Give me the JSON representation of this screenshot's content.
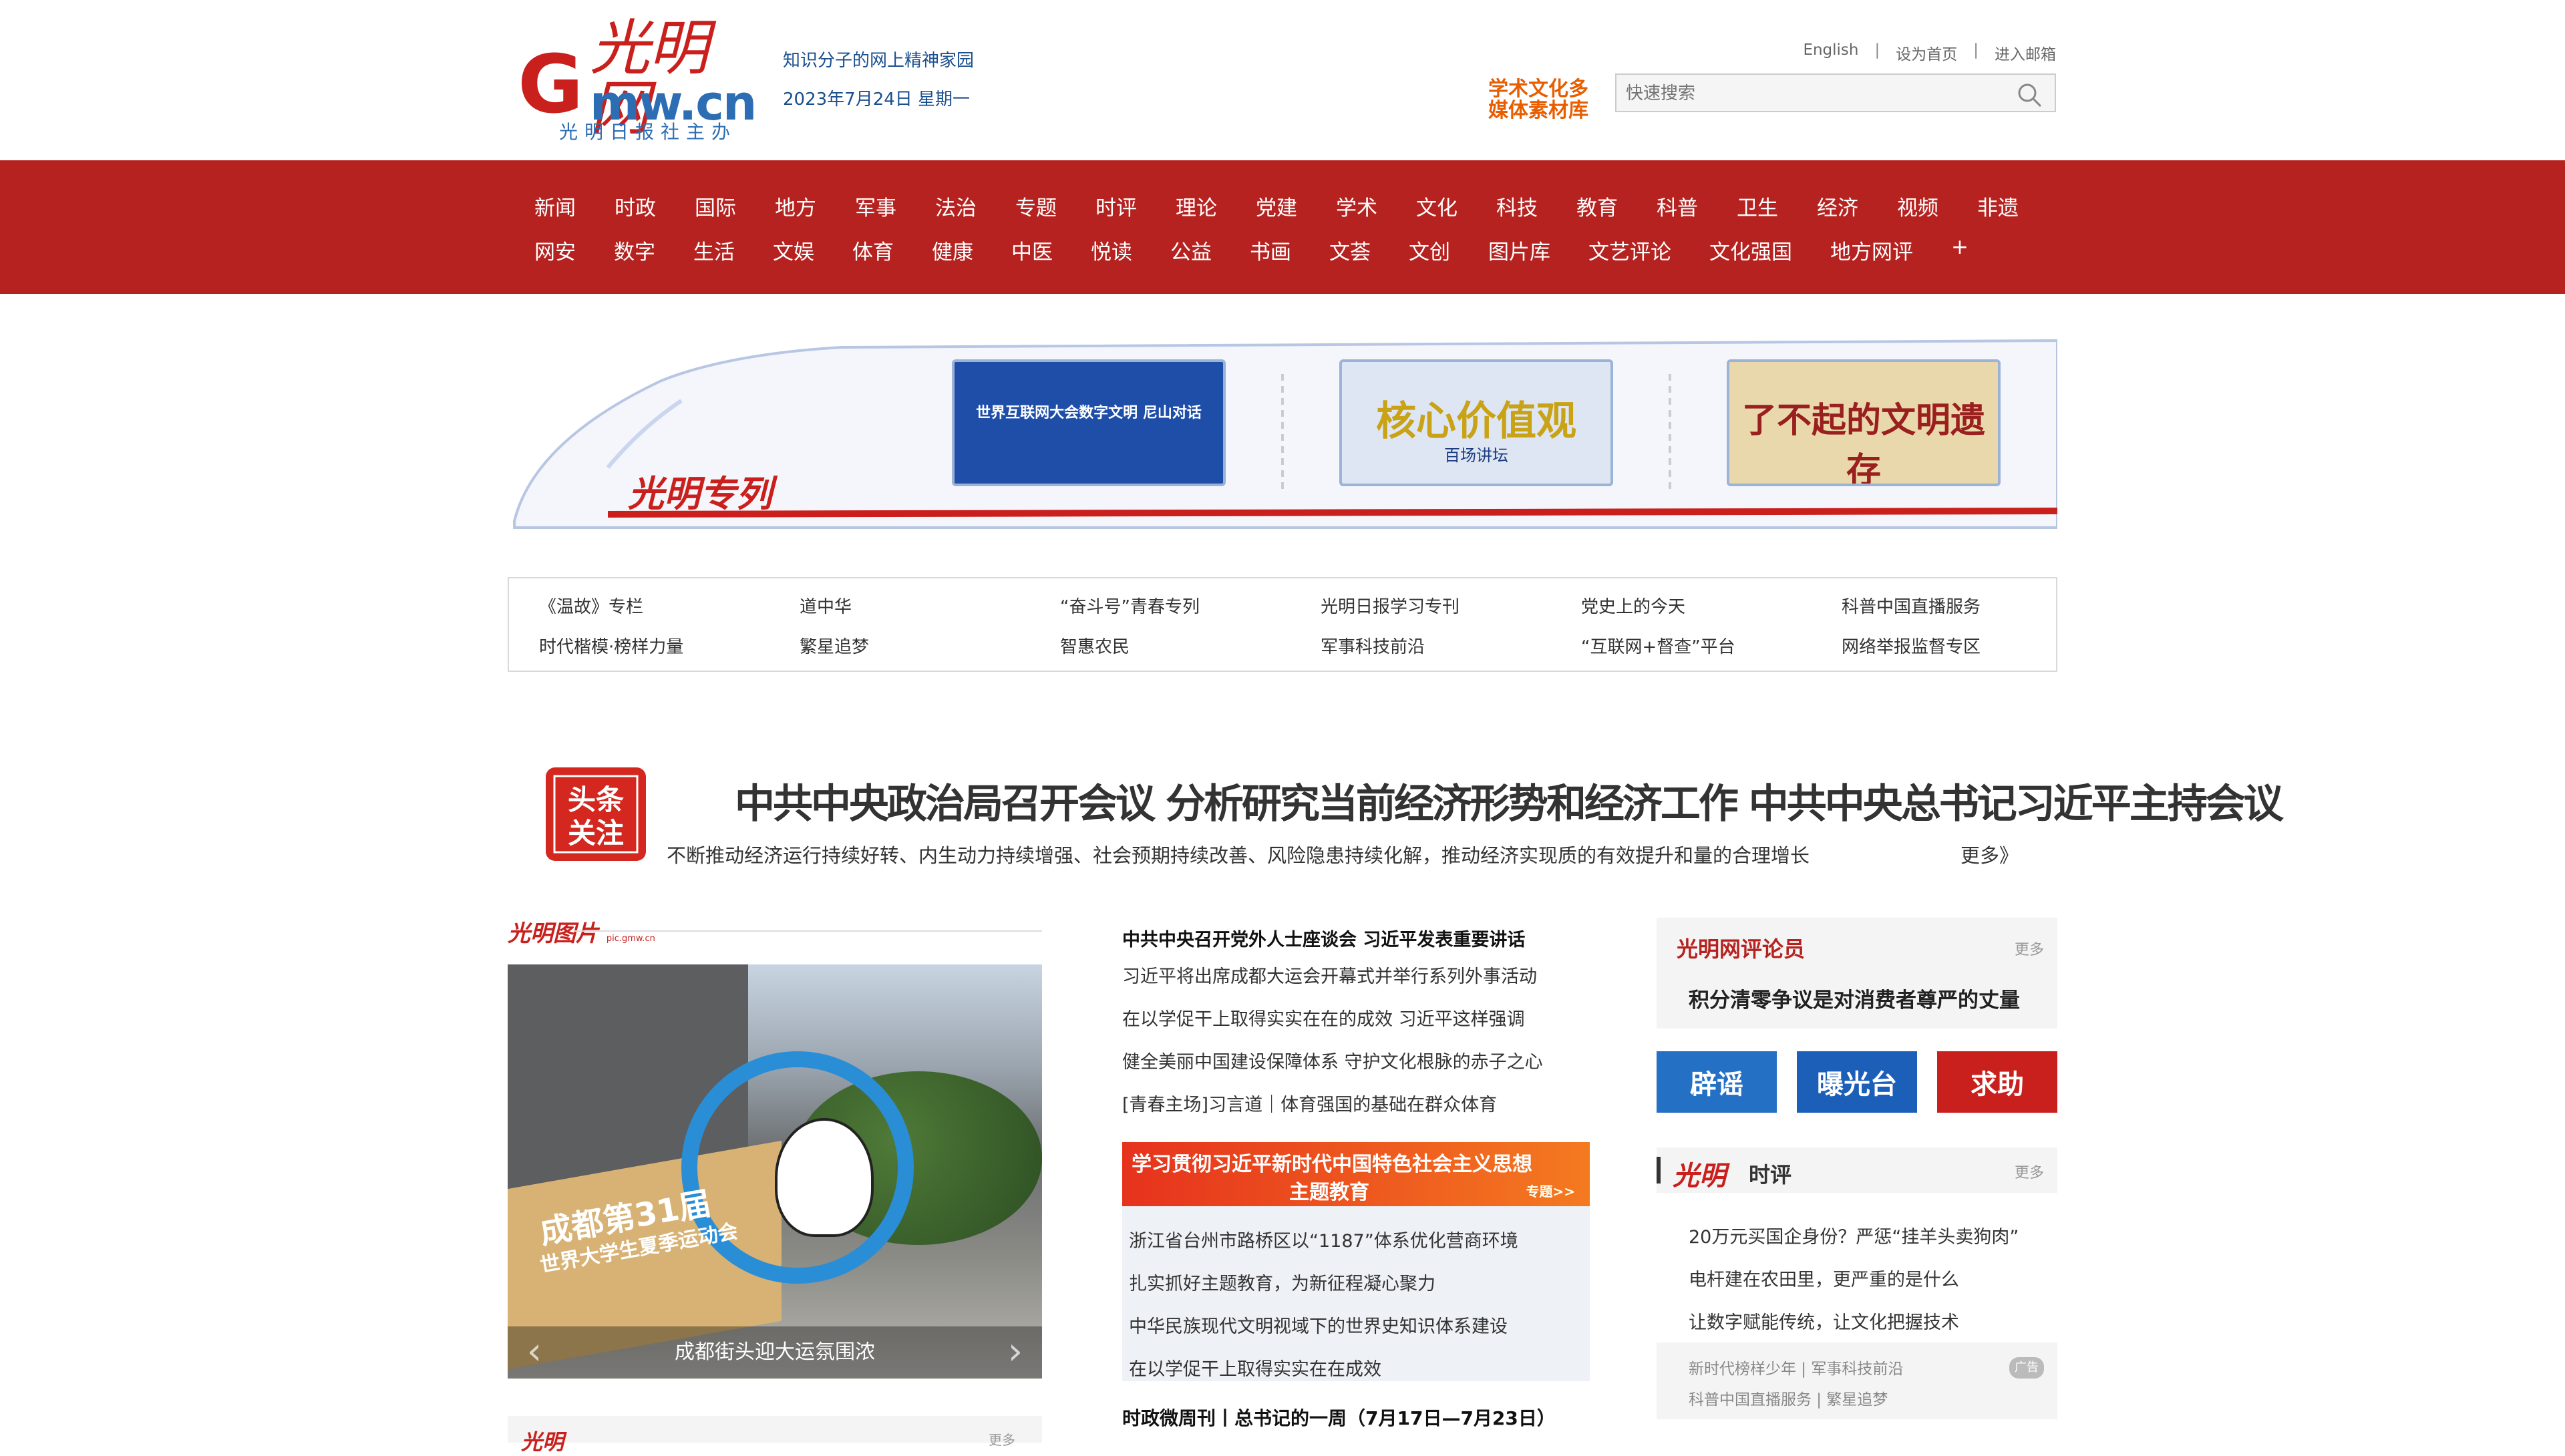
{
  "header": {
    "logo_cn": "光明网",
    "logo_g": "G",
    "logo_domain": "mw.cn",
    "logo_sub": "光明日报社主办",
    "slogan": "知识分子的网上精神家园",
    "date": "2023年7月24日   星期一",
    "links": [
      "English",
      "设为首页",
      "进入邮箱"
    ],
    "academic_label": "学术文化多媒体素材库",
    "search_placeholder": "快速搜索",
    "search_icon": "search-icon"
  },
  "nav": {
    "row1": [
      "新闻",
      "时政",
      "国际",
      "地方",
      "军事",
      "法治",
      "专题",
      "时评",
      "理论",
      "党建",
      "学术",
      "文化",
      "科技",
      "教育",
      "科普",
      "卫生",
      "经济",
      "视频",
      "非遗"
    ],
    "row2": [
      "网安",
      "数字",
      "生活",
      "文娱",
      "体育",
      "健康",
      "中医",
      "悦读",
      "公益",
      "书画",
      "文荟",
      "文创",
      "图片库",
      "文艺评论",
      "文化强国",
      "地方网评",
      "+"
    ]
  },
  "train": {
    "label": "光明专列",
    "cards": [
      {
        "title": "世界互联网大会数字文明 尼山对话"
      },
      {
        "title": "核心价值观",
        "sub": "百场讲坛"
      },
      {
        "title": "了不起的文明遗存"
      }
    ]
  },
  "special_links": {
    "row1": [
      "《温故》专栏",
      "道中华",
      "“奋斗号”青春专列",
      "光明日报学习专刊",
      "党史上的今天",
      "科普中国直播服务"
    ],
    "row2": [
      "时代楷模·榜样力量",
      "繁星追梦",
      "智惠农民",
      "军事科技前沿",
      "“互联网+督查”平台",
      "网络举报监督专区"
    ]
  },
  "headline": {
    "badge_line1": "头条",
    "badge_line2": "关注",
    "title": "中共中央政治局召开会议 分析研究当前经济形势和经济工作 中共中央总书记习近平主持会议",
    "subtitle": "不断推动经济运行持续好转、内生动力持续增强、社会预期持续改善、风险隐患持续化解，推动经济实现质的有效提升和量的合理增长",
    "more": "更多》"
  },
  "picture": {
    "label": "光明图片",
    "label_sub": "pic.gmw.cn",
    "sign_text": "成都第31届",
    "sign_text2": "世界大学生夏季运动会",
    "caption": "成都街头迎大运氛围浓"
  },
  "middle": {
    "top_title": "中共中央召开党外人士座谈会 习近平发表重要讲话",
    "news": [
      "习近平将出席成都大运会开幕式并举行系列外事活动",
      "在以学促干上取得实实在在的成效 习近平这样强调",
      "健全美丽中国建设保障体系 守护文化根脉的赤子之心",
      "[青春主场]习言道｜体育强国的基础在群众体育"
    ],
    "banner_t1": "学习贯彻习近平新时代中国特色社会主义思想",
    "banner_t2": "主题教育",
    "banner_t3": "专题>>",
    "box": [
      "浙江省台州市路桥区以“1187”体系优化营商环境",
      "扎实抓好主题教育，为新征程凝心聚力",
      "中华民族现代文明视域下的世界史知识体系建设",
      "在以学促干上取得实实在在成效"
    ],
    "weekly": "时政微周刊丨总书记的一周（7月17日—7月23日）"
  },
  "right": {
    "commentator_title": "光明网评论员",
    "more": "更多",
    "commentator_body": "积分清零争议是对消费者尊严的丈量",
    "tiles": [
      "辟谣",
      "曝光台",
      "求助"
    ],
    "review_logo": "光明",
    "review_title": "时评",
    "review_list": [
      "20万元买国企身份？严惩“挂羊头卖狗肉”",
      "电杆建在农田里，更严重的是什么",
      "让数字赋能传统，让文化把握技术"
    ],
    "ad_row1": "新时代榜样少年  |  军事科技前沿",
    "ad_row2": "科普中国直播服务  |  繁星追梦",
    "ad_tag": "广告"
  },
  "bottom": {
    "label": "光明",
    "more": "更多"
  }
}
